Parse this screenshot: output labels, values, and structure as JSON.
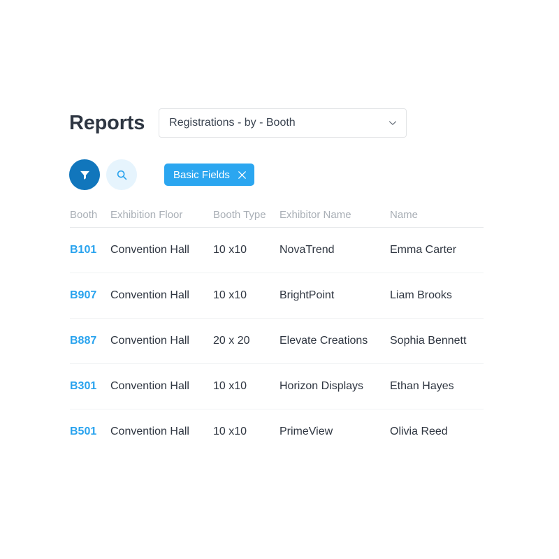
{
  "header": {
    "title": "Reports",
    "report_select": {
      "value": "Registrations - by - Booth",
      "icon": "chevron-down-icon"
    }
  },
  "toolbar": {
    "filter_button": {
      "icon": "filter-icon",
      "bg_color": "#1176bc",
      "icon_color": "#ffffff"
    },
    "search_button": {
      "icon": "search-icon",
      "bg_color": "#e6f4fd",
      "icon_color": "#29a3ee"
    },
    "chip": {
      "label": "Basic Fields",
      "close_icon": "close-icon",
      "bg_color": "#2ba6f0",
      "text_color": "#ffffff"
    }
  },
  "table": {
    "columns": [
      "Booth",
      "Exhibition Floor",
      "Booth Type",
      "Exhibitor Name",
      "Name"
    ],
    "rows": [
      {
        "booth": "B101",
        "floor": "Convention Hall",
        "type": "10 x10",
        "exhibitor": "NovaTrend",
        "name": "Emma Carter"
      },
      {
        "booth": "B907",
        "floor": "Convention Hall",
        "type": "10 x10",
        "exhibitor": "BrightPoint",
        "name": "Liam Brooks"
      },
      {
        "booth": "B887",
        "floor": "Convention Hall",
        "type": "20 x 20",
        "exhibitor": "Elevate Creations",
        "name": "Sophia Bennett"
      },
      {
        "booth": "B301",
        "floor": "Convention Hall",
        "type": "10 x10",
        "exhibitor": "Horizon Displays",
        "name": "Ethan Hayes"
      },
      {
        "booth": "B501",
        "floor": "Convention Hall",
        "type": "10 x10",
        "exhibitor": "PrimeView",
        "name": "Olivia Reed"
      }
    ]
  },
  "colors": {
    "link_blue": "#29a3ee",
    "primary_blue": "#1176bc",
    "chip_blue": "#2ba6f0",
    "title_dark": "#2e3642",
    "header_gray": "#a9afb6",
    "cell_dark": "#2f3641"
  }
}
